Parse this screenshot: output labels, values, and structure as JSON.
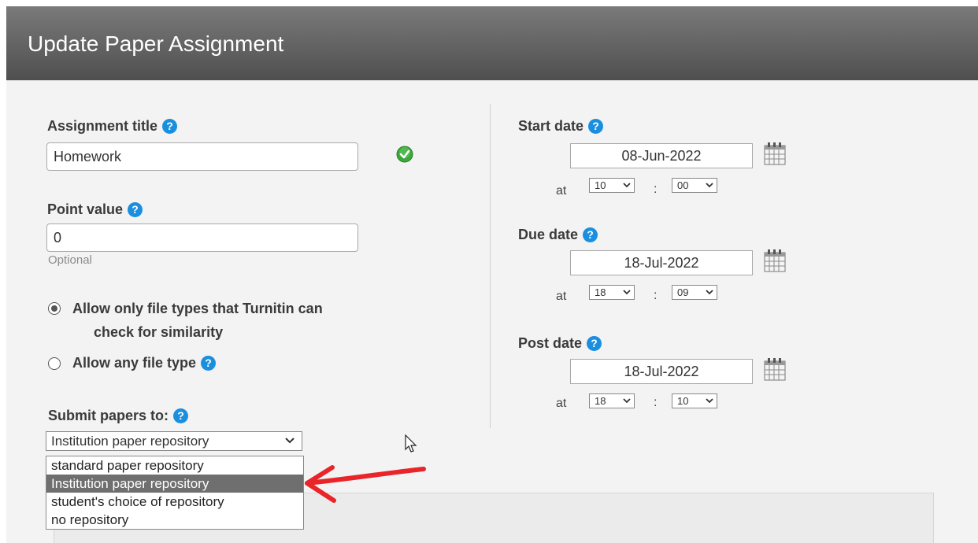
{
  "header": {
    "title": "Update Paper Assignment"
  },
  "left": {
    "assignment_title_label": "Assignment title",
    "assignment_title_value": "Homework",
    "point_value_label": "Point value",
    "point_value_value": "0",
    "point_value_hint": "Optional",
    "file_type_options": [
      {
        "label_line1": "Allow only file types that Turnitin can",
        "label_line2": "check for similarity",
        "checked": true
      },
      {
        "label_line1": "Allow any file type",
        "checked": false
      }
    ],
    "submit_label": "Submit papers to:",
    "submit_selected": "Institution paper repository",
    "submit_options": [
      "standard paper repository",
      "Institution paper repository",
      "student's choice of repository",
      "no repository"
    ]
  },
  "right": {
    "start": {
      "label": "Start date",
      "date": "08-Jun-2022",
      "at": "at",
      "hour": "10",
      "sep": ":",
      "minute": "00"
    },
    "due": {
      "label": "Due date",
      "date": "18-Jul-2022",
      "at": "at",
      "hour": "18",
      "sep": ":",
      "minute": "09"
    },
    "post": {
      "label": "Post date",
      "date": "18-Jul-2022",
      "at": "at",
      "hour": "18",
      "sep": ":",
      "minute": "10"
    }
  },
  "icons": {
    "help": "?",
    "help_color": "#1a8fe0",
    "valid": "check-circle",
    "valid_color": "#3aa83a"
  },
  "colors": {
    "header_top": "#7a7a7a",
    "header_bottom": "#4f4f4f",
    "arrow": "#e8262a",
    "highlight": "#6f6f6f"
  }
}
